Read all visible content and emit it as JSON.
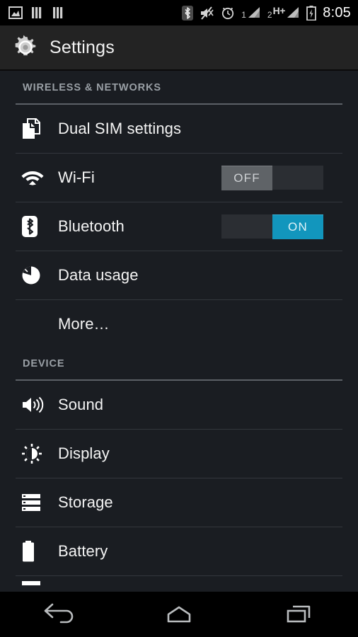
{
  "status_bar": {
    "left_icons": [
      {
        "name": "screenshot-image-icon"
      },
      {
        "name": "sim1-signal-bars-icon"
      },
      {
        "name": "sim2-signal-bars-icon"
      }
    ],
    "right_icons": [
      {
        "name": "bluetooth-icon"
      },
      {
        "name": "volume-muted-icon"
      },
      {
        "name": "alarm-clock-icon"
      }
    ],
    "sim1_label": "1",
    "sim2_label": "2",
    "network_type": "H+",
    "battery": "charging",
    "clock": "8:05"
  },
  "action_bar": {
    "icon": "gear-icon",
    "title": "Settings"
  },
  "sections": [
    {
      "header": "WIRELESS & NETWORKS",
      "rows": [
        {
          "label": "Dual SIM settings",
          "icon": "dual-sim-cards-icon",
          "toggle": null
        },
        {
          "label": "Wi-Fi",
          "icon": "wifi-icon",
          "toggle": {
            "state": "off",
            "label": "OFF"
          }
        },
        {
          "label": "Bluetooth",
          "icon": "bluetooth-icon",
          "toggle": {
            "state": "on",
            "label": "ON"
          }
        },
        {
          "label": "Data usage",
          "icon": "pie-chart-icon",
          "toggle": null
        },
        {
          "label": "More…",
          "icon": null,
          "toggle": null
        }
      ]
    },
    {
      "header": "DEVICE",
      "rows": [
        {
          "label": "Sound",
          "icon": "speaker-volume-icon",
          "toggle": null
        },
        {
          "label": "Display",
          "icon": "brightness-sun-icon",
          "toggle": null
        },
        {
          "label": "Storage",
          "icon": "storage-stack-icon",
          "toggle": null
        },
        {
          "label": "Battery",
          "icon": "battery-icon",
          "toggle": null
        }
      ]
    }
  ],
  "nav_bar": {
    "back": "back-icon",
    "home": "home-icon",
    "recents": "recent-apps-icon"
  },
  "colors": {
    "toggle_on": "#1296bd",
    "toggle_off_thumb": "#5f6367",
    "list_background": "#1a1d22",
    "action_bar_background": "#232323",
    "section_header_text": "#9aa0a6"
  }
}
